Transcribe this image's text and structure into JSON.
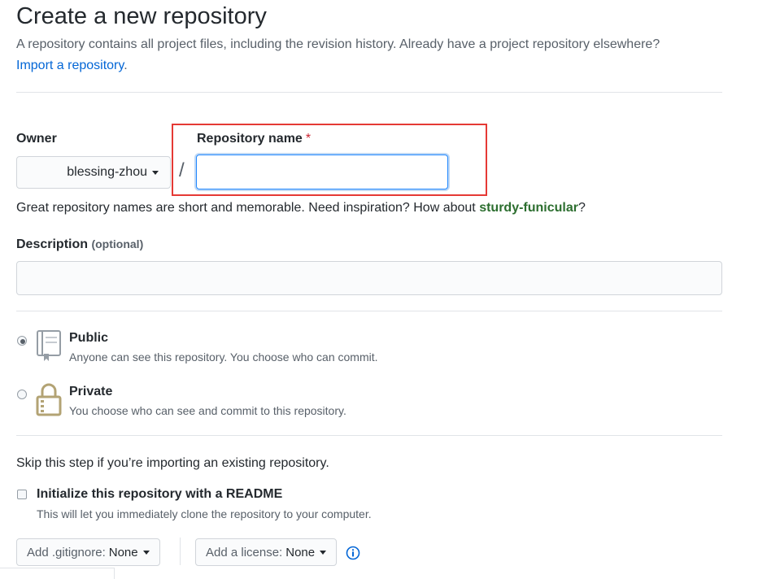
{
  "page": {
    "title": "Create a new repository",
    "subtitle": "A repository contains all project files, including the revision history. Already have a project repository elsewhere?",
    "import_link": "Import a repository",
    "import_suffix": "."
  },
  "owner": {
    "label": "Owner",
    "value": "blessing-zhou"
  },
  "separator": "/",
  "repo_name": {
    "label": "Repository name",
    "required_marker": "*",
    "value": "",
    "placeholder": ""
  },
  "hint": {
    "text": "Great repository names are short and memorable. Need inspiration? How about ",
    "suggestion": "sturdy-funicular",
    "suffix": "?"
  },
  "description": {
    "label": "Description",
    "optional": "(optional)",
    "value": "",
    "placeholder": ""
  },
  "visibility": {
    "selected": "public",
    "options": [
      {
        "id": "public",
        "title": "Public",
        "note": "Anyone can see this repository. You choose who can commit.",
        "icon": "repo-icon"
      },
      {
        "id": "private",
        "title": "Private",
        "note": "You choose who can see and commit to this repository.",
        "icon": "lock-icon"
      }
    ]
  },
  "init": {
    "skip_text": "Skip this step if you’re importing an existing repository.",
    "readme_label": "Initialize this repository with a README",
    "readme_note": "This will let you immediately clone the repository to your computer.",
    "readme_checked": false
  },
  "gitignore": {
    "label": "Add .gitignore:",
    "value": "None"
  },
  "license": {
    "label": "Add a license:",
    "value": "None"
  },
  "colors": {
    "link": "#0366d6",
    "highlight_border": "#e53935",
    "required": "#cb2431",
    "suggestion": "#2c6e2f",
    "lock_icon": "#b3a374"
  }
}
